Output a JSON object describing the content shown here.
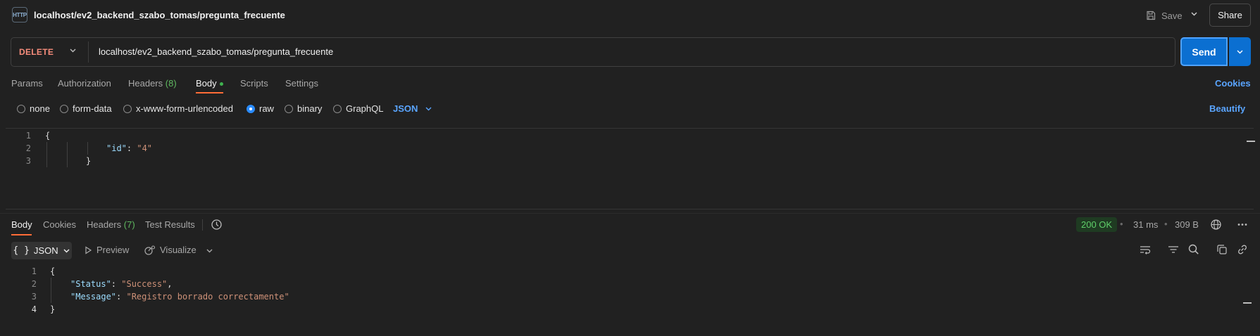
{
  "header": {
    "icon_text": "HTTP",
    "title": "localhost/ev2_backend_szabo_tomas/pregunta_frecuente",
    "save_label": "Save",
    "share_label": "Share"
  },
  "request": {
    "method": "DELETE",
    "url": "localhost/ev2_backend_szabo_tomas/pregunta_frecuente",
    "send_label": "Send",
    "method_color": "#f58c7b"
  },
  "request_tabs": {
    "params": "Params",
    "authorization": "Authorization",
    "headers": "Headers",
    "headers_count": "(8)",
    "body": "Body",
    "scripts": "Scripts",
    "settings": "Settings",
    "cookies": "Cookies"
  },
  "body_types": {
    "none": "none",
    "form_data": "form-data",
    "urlencoded": "x-www-form-urlencoded",
    "raw": "raw",
    "binary": "binary",
    "graphql": "GraphQL",
    "selected_format": "JSON",
    "beautify": "Beautify"
  },
  "request_editor": {
    "line_numbers": [
      "1",
      "2",
      "3"
    ],
    "line1": "{",
    "line2_key": "\"id\"",
    "line2_colon": ": ",
    "line2_value": "\"4\"",
    "line3": "}"
  },
  "response_tabs": {
    "body": "Body",
    "cookies": "Cookies",
    "headers": "Headers",
    "headers_count": "(7)",
    "test_results": "Test Results"
  },
  "response_meta": {
    "status": "200 OK",
    "time": "31 ms",
    "size": "309 B",
    "status_color": "#5fd06a"
  },
  "response_toolbar": {
    "format_icon": "{ }",
    "format": "JSON",
    "preview": "Preview",
    "visualize": "Visualize"
  },
  "response_editor": {
    "line_numbers": [
      "1",
      "2",
      "3",
      "4"
    ],
    "line1": "{",
    "line2_key": "\"Status\"",
    "line2_sep": ": ",
    "line2_value": "\"Success\"",
    "line2_end": ",",
    "line3_key": "\"Message\"",
    "line3_sep": ": ",
    "line3_value": "\"Registro borrado correctamente\"",
    "line4": "}"
  },
  "icons": {
    "save": "save-icon",
    "history": "history-icon",
    "globe": "globe-icon",
    "more": "more-icon",
    "wrap": "wrap-lines-icon",
    "filter": "filter-icon",
    "search": "search-icon",
    "copy": "copy-icon",
    "link": "link-icon"
  }
}
